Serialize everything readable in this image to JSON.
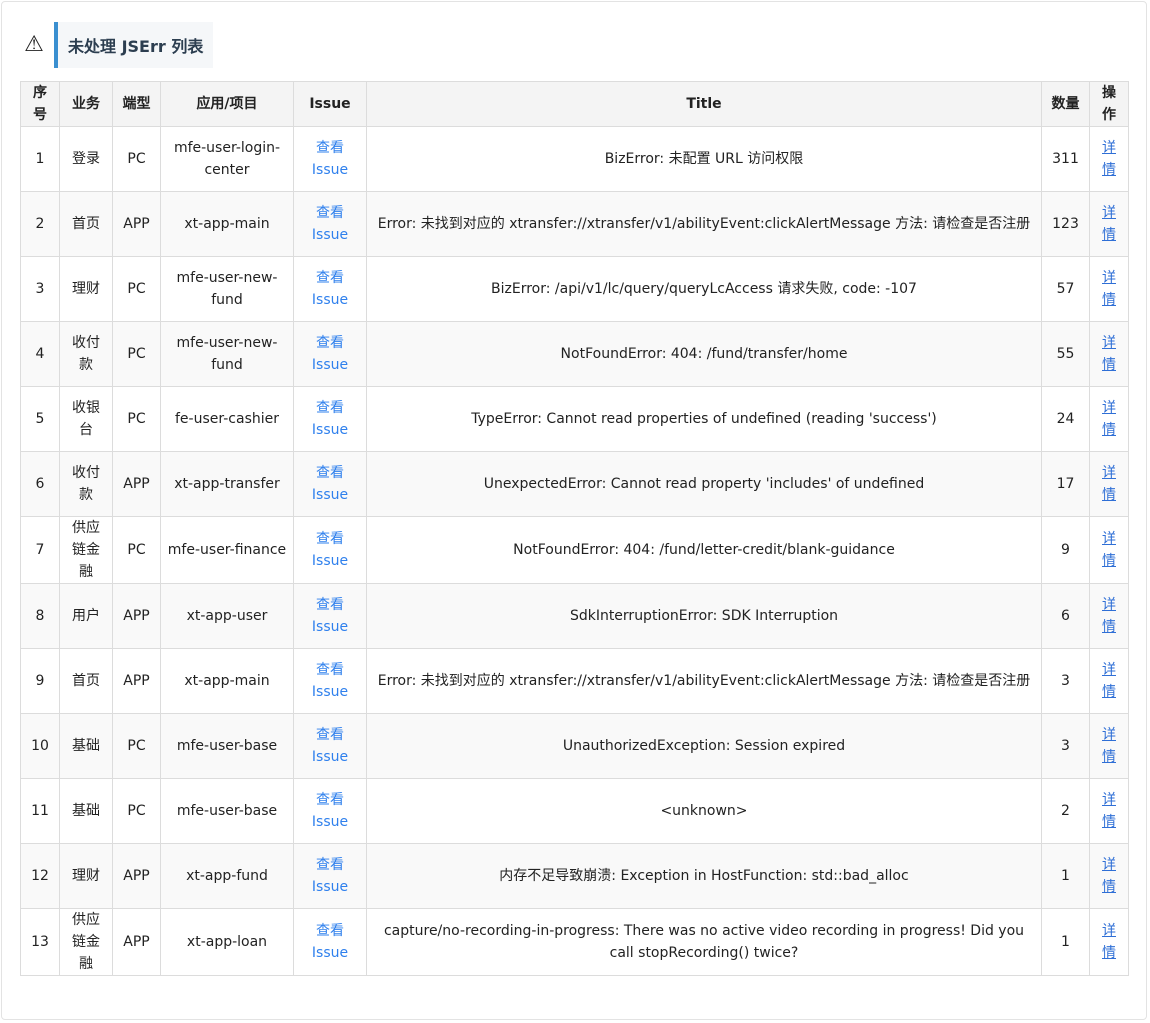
{
  "header": {
    "icon": "warning-icon",
    "title": "未处理 JSErr 列表"
  },
  "table": {
    "columns": [
      "序号",
      "业务",
      "端型",
      "应用/项目",
      "Issue",
      "Title",
      "数量",
      "操作"
    ],
    "rows": [
      {
        "no": "1",
        "biz": "登录",
        "platform": "PC",
        "app": "mfe-user-login-center",
        "issue": "查看 Issue",
        "title": "BizError: 未配置 URL 访问权限",
        "count": "311",
        "action": "详情"
      },
      {
        "no": "2",
        "biz": "首页",
        "platform": "APP",
        "app": "xt-app-main",
        "issue": "查看 Issue",
        "title": "Error: 未找到对应的 xtransfer://xtransfer/v1/abilityEvent:clickAlertMessage 方法: 请检查是否注册",
        "count": "123",
        "action": "详情"
      },
      {
        "no": "3",
        "biz": "理财",
        "platform": "PC",
        "app": "mfe-user-new-fund",
        "issue": "查看 Issue",
        "title": "BizError: /api/v1/lc/query/queryLcAccess 请求失败, code: -107",
        "count": "57",
        "action": "详情"
      },
      {
        "no": "4",
        "biz": "收付款",
        "platform": "PC",
        "app": "mfe-user-new-fund",
        "issue": "查看 Issue",
        "title": "NotFoundError: 404: /fund/transfer/home",
        "count": "55",
        "action": "详情"
      },
      {
        "no": "5",
        "biz": "收银台",
        "platform": "PC",
        "app": "fe-user-cashier",
        "issue": "查看 Issue",
        "title": "TypeError: Cannot read properties of undefined (reading 'success')",
        "count": "24",
        "action": "详情"
      },
      {
        "no": "6",
        "biz": "收付款",
        "platform": "APP",
        "app": "xt-app-transfer",
        "issue": "查看 Issue",
        "title": "UnexpectedError: Cannot read property 'includes' of undefined",
        "count": "17",
        "action": "详情"
      },
      {
        "no": "7",
        "biz": "供应链金融",
        "platform": "PC",
        "app": "mfe-user-finance",
        "issue": "查看 Issue",
        "title": "NotFoundError: 404: /fund/letter-credit/blank-guidance",
        "count": "9",
        "action": "详情"
      },
      {
        "no": "8",
        "biz": "用户",
        "platform": "APP",
        "app": "xt-app-user",
        "issue": "查看 Issue",
        "title": "SdkInterruptionError: SDK Interruption",
        "count": "6",
        "action": "详情"
      },
      {
        "no": "9",
        "biz": "首页",
        "platform": "APP",
        "app": "xt-app-main",
        "issue": "查看 Issue",
        "title": "Error: 未找到对应的 xtransfer://xtransfer/v1/abilityEvent:clickAlertMessage 方法: 请检查是否注册",
        "count": "3",
        "action": "详情"
      },
      {
        "no": "10",
        "biz": "基础",
        "platform": "PC",
        "app": "mfe-user-base",
        "issue": "查看 Issue",
        "title": "UnauthorizedException: Session expired",
        "count": "3",
        "action": "详情"
      },
      {
        "no": "11",
        "biz": "基础",
        "platform": "PC",
        "app": "mfe-user-base",
        "issue": "查看 Issue",
        "title": "<unknown>",
        "count": "2",
        "action": "详情"
      },
      {
        "no": "12",
        "biz": "理财",
        "platform": "APP",
        "app": "xt-app-fund",
        "issue": "查看 Issue",
        "title": "内存不足导致崩溃: Exception in HostFunction: std::bad_alloc",
        "count": "1",
        "action": "详情"
      },
      {
        "no": "13",
        "biz": "供应链金融",
        "platform": "APP",
        "app": "xt-app-loan",
        "issue": "查看 Issue",
        "title": "capture/no-recording-in-progress: There was no active video recording in progress! Did you call stopRecording() twice?",
        "count": "1",
        "action": "详情"
      }
    ]
  },
  "colors": {
    "accent": "#3a8fd0",
    "link": "#2f80ed",
    "header_bg": "#f4f4f4",
    "stripe_bg": "#f9f9f9"
  }
}
